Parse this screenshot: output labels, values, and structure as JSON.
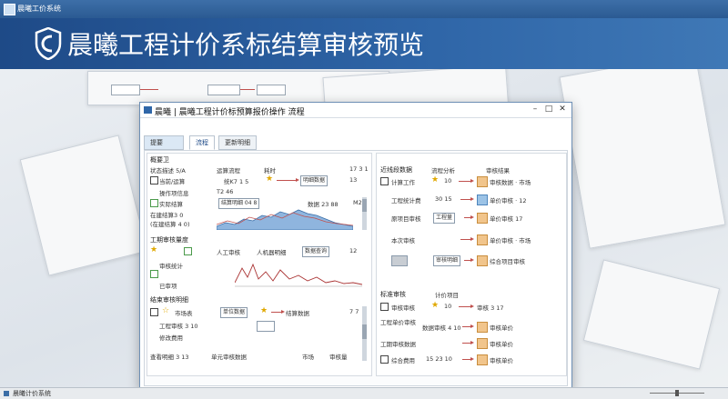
{
  "app": {
    "titlebar": "晨曦工价系统",
    "banner_title": "晨曦工程计价系标结算审核预览"
  },
  "window": {
    "title": "晨曦 | 晨曦工程计价标预算报价操作 流程"
  },
  "tabs": [
    {
      "label": "提要"
    },
    {
      "label": "流程"
    },
    {
      "label": "更新明细"
    }
  ],
  "left": {
    "section1": "概要卫",
    "row_header": [
      "状态描述 5/A",
      "运算流程",
      "耗时",
      "17 3 1"
    ],
    "rows": [
      {
        "a": "当前/运算",
        "b": "统K7 1 5",
        "c": "明细数据",
        "d": "13"
      },
      {
        "a": "操作项信息",
        "b": "T2 46"
      },
      {
        "a": "实际结算",
        "b": "结算明细 04 8",
        "c": "数据 23 88",
        "d": "M2"
      },
      {
        "a": "在建结算3 0",
        "b": ""
      },
      {
        "a": "(在建结算 4 0)",
        "b": ""
      }
    ],
    "section2": "工期审核量度",
    "rows2": [
      {
        "a": "人工审核",
        "b": "人机器明细",
        "c": "数据查询",
        "d": "12"
      },
      {
        "a": "审核统计",
        "b": ""
      },
      {
        "a": "已审项",
        "b": ""
      }
    ],
    "section3": "结束审核明细",
    "rows3": [
      {
        "a": "市场表",
        "b": "单位数据",
        "c": "结算数据",
        "d": "7 7"
      },
      {
        "a": "工程审核 3 10",
        "b": ""
      },
      {
        "a": "修改费用",
        "b": ""
      },
      {
        "a": "查看明细 3 13",
        "b": "单元审核数据",
        "c": "市场",
        "d": "审核量"
      }
    ]
  },
  "right": {
    "section1": "近线段数据",
    "header": [
      "流程分析",
      "审核结果"
    ],
    "rows": [
      {
        "a": "计算工作",
        "b": "10",
        "c": "审核数据 · 市场"
      },
      {
        "a": "工程统计费",
        "b": "30 15",
        "c": "单价审核 · 12"
      },
      {
        "a": "原项目审核",
        "b": "工程量",
        "c": "单价审核 17"
      },
      {
        "a": "本次审核",
        "b": "",
        "c": "单价审核 · 市场"
      },
      {
        "a": "",
        "b": "审核明细",
        "c": "综合项目审核"
      }
    ],
    "section2": "标准审核",
    "header2": [
      "计价项目"
    ],
    "rows2": [
      {
        "a": "审核审核",
        "b": "10",
        "c": "审核 3 17"
      },
      {
        "a": "工程单价审核",
        "b": "数据审核 4 10",
        "c": "审核单价"
      },
      {
        "a": "工期审核数据",
        "b": "",
        "c": "审核单价"
      },
      {
        "a": "综合费用",
        "b": "15 23 10",
        "c": "审核单价"
      }
    ]
  },
  "status": {
    "text": "晨曦计价系统"
  },
  "colors": {
    "accent": "#2f66a8",
    "banner": "#1e4a87",
    "arrow": "#c0504d",
    "tan": "#f1c58c"
  }
}
